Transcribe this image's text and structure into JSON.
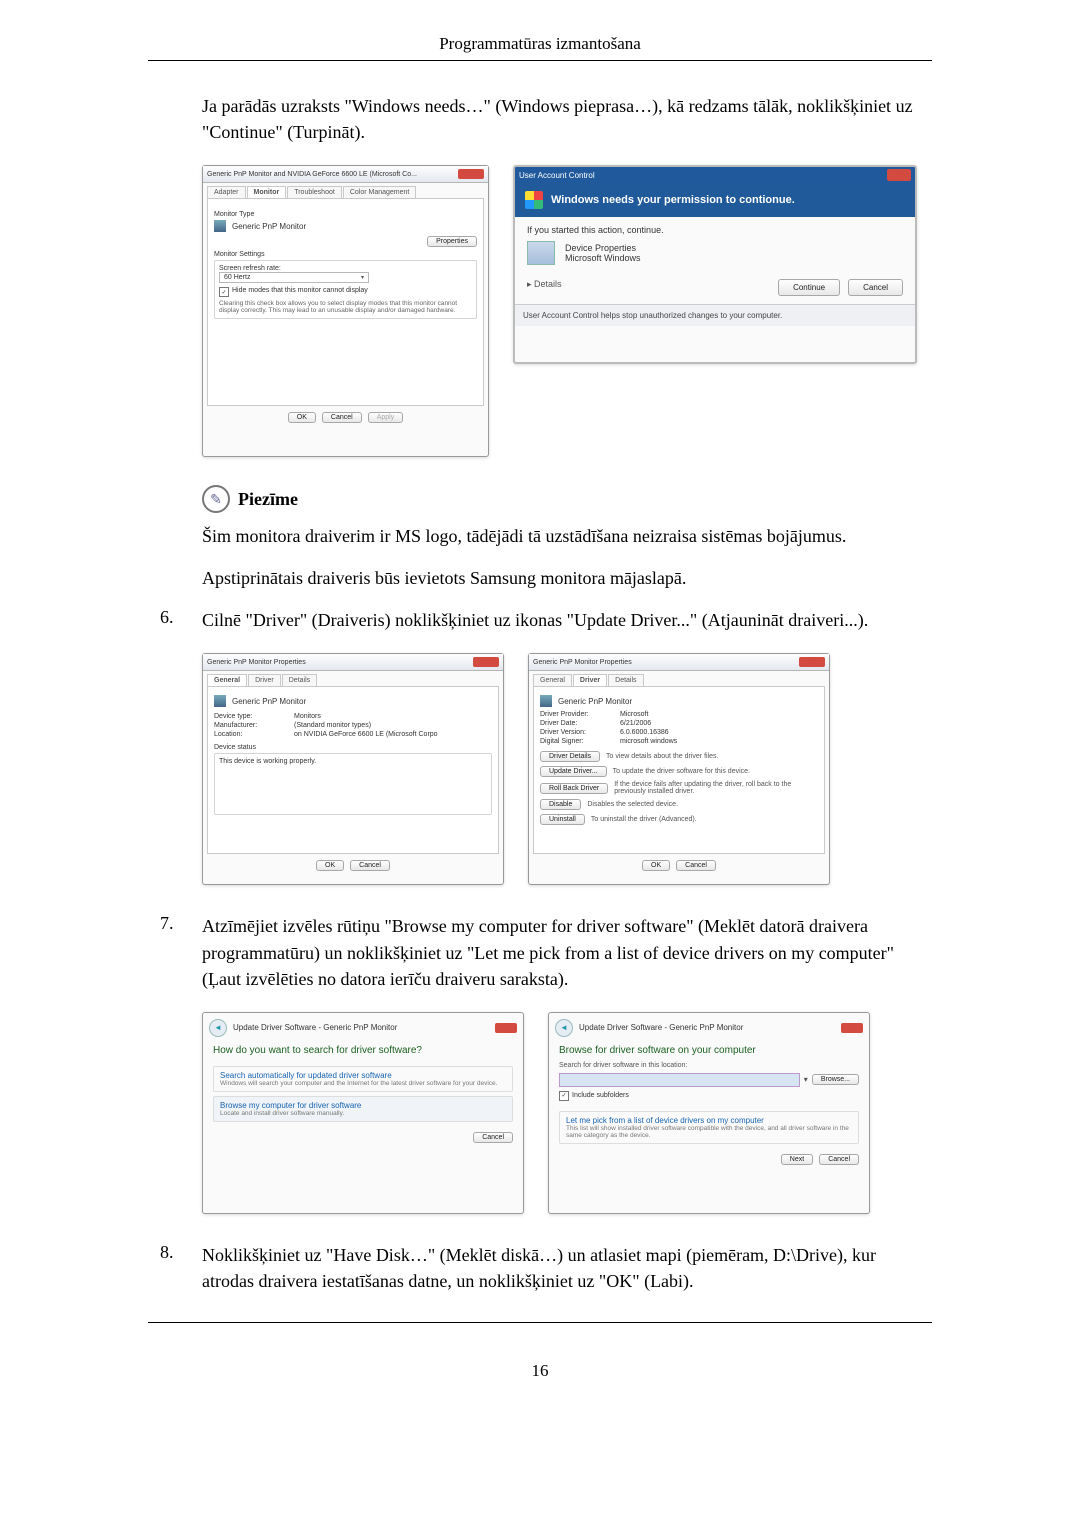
{
  "header": {
    "title": "Programmatūras izmantošana"
  },
  "footer": {
    "page": "16"
  },
  "steps": {
    "step5_intro": "Ja parādās uzraksts \"Windows needs…\" (Windows pieprasa…), kā redzams tālāk, noklikšķiniet uz \"Continue\" (Turpināt).",
    "step6": {
      "num": "6.",
      "text": "Cilnē \"Driver\" (Draiveris) noklikšķiniet uz ikonas \"Update Driver...\" (Atjaunināt draiveri...)."
    },
    "step7": {
      "num": "7.",
      "text": "Atzīmējiet izvēles rūtiņu \"Browse my computer for driver software\" (Meklēt datorā draivera programmatūru) un noklikšķiniet uz \"Let me pick from a list of device drivers on my computer\" (Ļaut izvēlēties no datora ierīču draiveru saraksta)."
    },
    "step8": {
      "num": "8.",
      "text": "Noklikšķiniet uz \"Have Disk…\" (Meklēt diskā…) un atlasiet mapi (piemēram, D:\\Drive), kur atrodas draivera iestatīšanas datne, un noklikšķiniet uz \"OK\" (Labi)."
    }
  },
  "note": {
    "label": "Piezīme",
    "line1": "Šim monitora draiverim ir MS logo, tādējādi tā uzstādīšana neizraisa sistēmas bojājumus.",
    "line2": "Apstiprinātais draiveris būs ievietots Samsung monitora mājaslapā."
  },
  "shots": {
    "common": {
      "ok": "OK",
      "cancel": "Cancel",
      "apply": "Apply",
      "next": "Next"
    },
    "monitor": {
      "title": "Generic PnP Monitor and NVIDIA GeForce 6600 LE (Microsoft Co...",
      "tabs": [
        "Adapter",
        "Monitor",
        "Troubleshoot",
        "Color Management"
      ],
      "group1": "Monitor Type",
      "monitor_name": "Generic PnP Monitor",
      "properties_btn": "Properties",
      "group2": "Monitor Settings",
      "refresh_label": "Screen refresh rate:",
      "refresh_value": "60 Hertz",
      "hide_modes": "Hide modes that this monitor cannot display",
      "hint": "Clearing this check box allows you to select display modes that this monitor cannot display correctly. This may lead to an unusable display and/or damaged hardware."
    },
    "uac": {
      "title": "User Account Control",
      "message": "Windows needs your permission to contionue.",
      "prompt": "If you started this action, continue.",
      "program": "Device Properties",
      "publisher": "Microsoft Windows",
      "details": "Details",
      "continue_btn": "Continue",
      "footer": "User Account Control helps stop unauthorized changes to your computer."
    },
    "pnp_general": {
      "title": "Generic PnP Monitor Properties",
      "tabs": [
        "General",
        "Driver",
        "Details"
      ],
      "device": "Generic PnP Monitor",
      "rows": [
        {
          "k": "Device type:",
          "v": "Monitors"
        },
        {
          "k": "Manufacturer:",
          "v": "(Standard monitor types)"
        },
        {
          "k": "Location:",
          "v": "on NVIDIA GeForce 6600 LE (Microsoft Corpo"
        }
      ],
      "status_label": "Device status",
      "status_text": "This device is working properly."
    },
    "pnp_driver": {
      "title": "Generic PnP Monitor Properties",
      "tabs": [
        "General",
        "Driver",
        "Details"
      ],
      "device": "Generic PnP Monitor",
      "rows": [
        {
          "k": "Driver Provider:",
          "v": "Microsoft"
        },
        {
          "k": "Driver Date:",
          "v": "6/21/2006"
        },
        {
          "k": "Driver Version:",
          "v": "6.0.6000.16386"
        },
        {
          "k": "Digital Signer:",
          "v": "microsoft windows"
        }
      ],
      "buttons": [
        {
          "label": "Driver Details",
          "desc": "To view details about the driver files."
        },
        {
          "label": "Update Driver...",
          "desc": "To update the driver software for this device."
        },
        {
          "label": "Roll Back Driver",
          "desc": "If the device fails after updating the driver, roll back to the previously installed driver."
        },
        {
          "label": "Disable",
          "desc": "Disables the selected device."
        },
        {
          "label": "Uninstall",
          "desc": "To uninstall the driver (Advanced)."
        }
      ]
    },
    "wizL": {
      "title": "Update Driver Software - Generic PnP Monitor",
      "heading": "How do you want to search for driver software?",
      "opts": [
        {
          "t": "Search automatically for updated driver software",
          "d": "Windows will search your computer and the Internet for the latest driver software for your device."
        },
        {
          "t": "Browse my computer for driver software",
          "d": "Locate and install driver software manually."
        }
      ]
    },
    "wizR": {
      "title": "Update Driver Software - Generic PnP Monitor",
      "heading": "Browse for driver software on your computer",
      "loc_label": "Search for driver software in this location:",
      "browse_btn": "Browse...",
      "subfolders": "Include subfolders",
      "pick": {
        "t": "Let me pick from a list of device drivers on my computer",
        "d": "This list will show installed driver software compatible with the device, and all driver software in the same category as the device."
      }
    }
  }
}
